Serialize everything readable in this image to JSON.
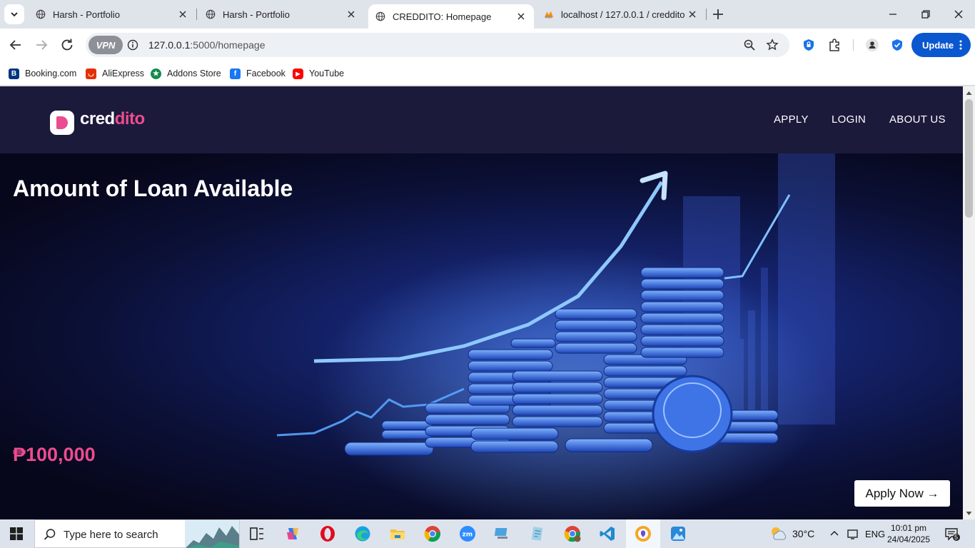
{
  "browser": {
    "tabs": [
      {
        "title": "Harsh - Portfolio",
        "active": false
      },
      {
        "title": "Harsh - Portfolio",
        "active": false
      },
      {
        "title": "CREDDITO: Homepage",
        "active": true
      },
      {
        "title": "localhost / 127.0.0.1 / creddito",
        "active": false
      }
    ],
    "vpn_label": "VPN",
    "url_host": "127.0.0.1",
    "url_path": ":5000/homepage",
    "update_label": "Update",
    "bookmarks": [
      {
        "label": "Booking.com",
        "icon": "booking-icon",
        "color": "#003580"
      },
      {
        "label": "AliExpress",
        "icon": "aliexpress-icon",
        "color": "#e62e04"
      },
      {
        "label": "Addons Store",
        "icon": "addons-store-icon",
        "color": "#138a4c"
      },
      {
        "label": "Facebook",
        "icon": "facebook-icon",
        "color": "#1877f2"
      },
      {
        "label": "YouTube",
        "icon": "youtube-icon",
        "color": "#ff0000"
      }
    ]
  },
  "site": {
    "logo_a": "cred",
    "logo_b": "dito",
    "nav": {
      "apply": "APPLY",
      "login": "LOGIN",
      "about": "ABOUT US"
    },
    "hero_title": "Amount of Loan Available",
    "hero_amount": "₱100,000",
    "apply_now": "Apply Now →",
    "colors": {
      "accent": "#ec4c8f",
      "header_bg": "#1b1a3b"
    }
  },
  "taskbar": {
    "search_placeholder": "Type here to search",
    "weather": "30°C",
    "language": "ENG",
    "time": "10:01 pm",
    "date": "24/04/2025",
    "notifications": "5"
  }
}
